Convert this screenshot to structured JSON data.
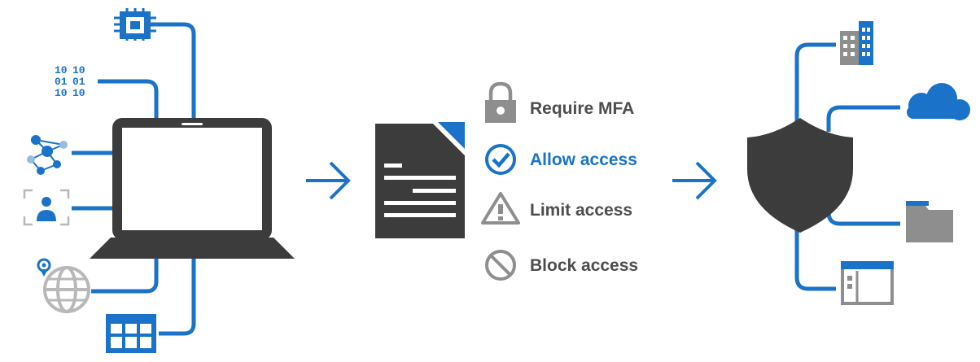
{
  "colors": {
    "accent": "#1a73c9",
    "dark": "#3c3c3c",
    "gray": "#8e8e8e",
    "light_gray": "#b8b8b8",
    "text_dark": "#4d4d4d"
  },
  "icons_left": [
    "cpu-chip-icon",
    "binary-code-icon",
    "network-graph-icon",
    "user-scan-icon",
    "globe-location-icon",
    "app-grid-icon"
  ],
  "policy": {
    "items": [
      {
        "icon": "lock-icon",
        "label": "Require MFA"
      },
      {
        "icon": "check-circle-icon",
        "label": "Allow access"
      },
      {
        "icon": "warning-icon",
        "label": "Limit access"
      },
      {
        "icon": "block-icon",
        "label": "Block access"
      }
    ]
  },
  "icons_right": [
    "building-icon",
    "cloud-icon",
    "folder-icon",
    "app-window-icon"
  ]
}
